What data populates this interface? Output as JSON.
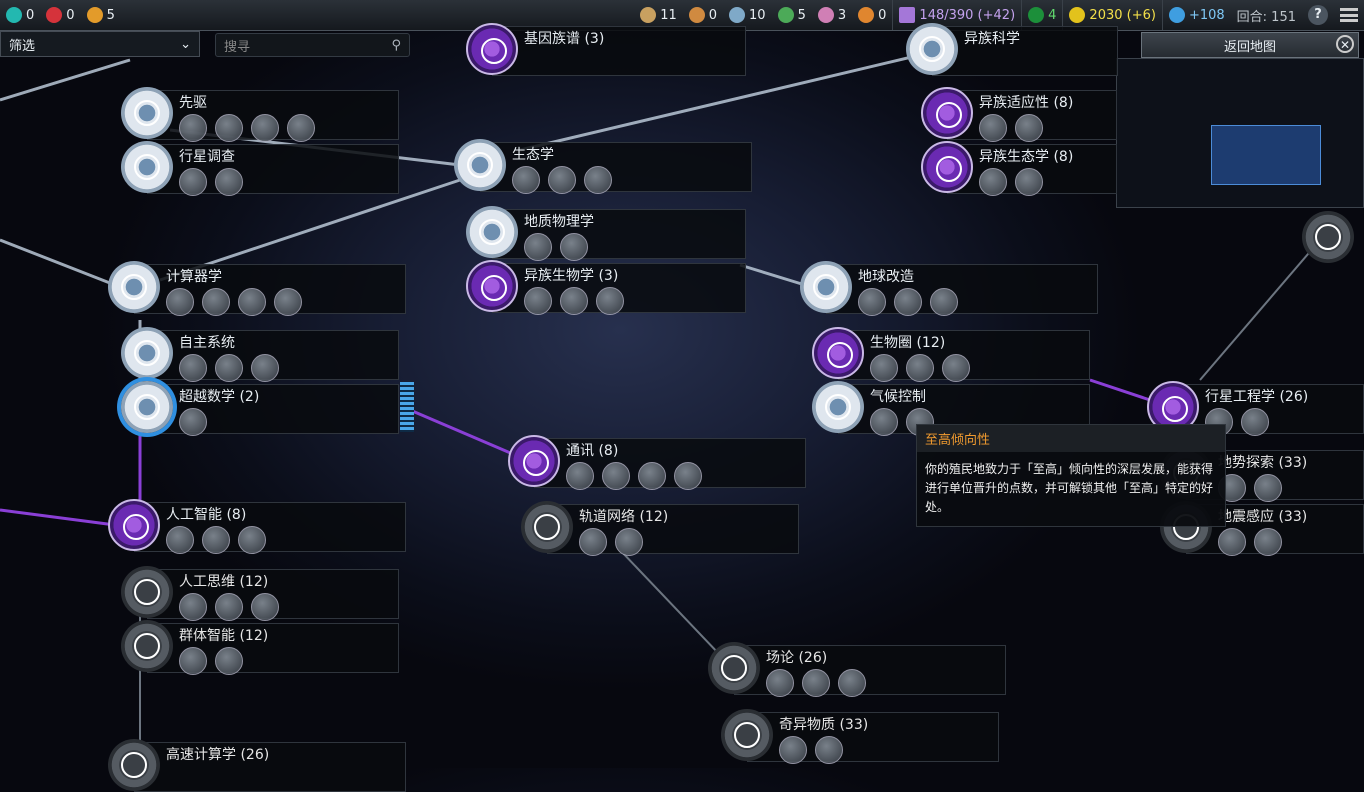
{
  "topbar": {
    "energy": "0",
    "conflict": "0",
    "supremacy": "5",
    "res1": "11",
    "res2": "0",
    "res3": "10",
    "res4": "5",
    "res5": "3",
    "res6": "0",
    "science_progress": "148/390 (+42)",
    "health": "4",
    "energy_income": "2030 (+6)",
    "science_income": "+108",
    "turn": "回合: 151",
    "help": "?"
  },
  "filter": {
    "label": "筛选"
  },
  "search": {
    "placeholder": "搜寻"
  },
  "back_button": "返回地图",
  "tooltip": {
    "title": "至高倾向性",
    "body": "你的殖民地致力于「至高」倾向性的深层发展，能获得进行单位晋升的点数，并可解锁其他「至高」特定的好处。"
  },
  "techs": {
    "genetics": "基因族谱 (3)",
    "xeno_science": "异族科学",
    "pioneer": "先驱",
    "planet_survey": "行星调查",
    "ecology": "生态学",
    "xeno_adaptation": "异族适应性 (8)",
    "xeno_ecology": "异族生态学 (8)",
    "geophysics": "地质物理学",
    "xeno_biology": "异族生物学 (3)",
    "computing": "计算器学",
    "terraforming": "地球改造",
    "autonomous": "自主系统",
    "biosphere": "生物圈 (12)",
    "transcendental_math": "超越数学 (2)",
    "climate_control": "气候控制",
    "planetary_engineering": "行星工程学 (26)",
    "communications": "通讯 (8)",
    "geo_survey": "地势探索 (33)",
    "orbital_networks": "轨道网络 (12)",
    "seismic_sensing": "地震感应 (33)",
    "ai": "人工智能 (8)",
    "artificial_mind": "人工思维 (12)",
    "swarm_intelligence": "群体智能 (12)",
    "field_theory": "场论 (26)",
    "exotic_matter": "奇异物质 (33)",
    "hpc": "高速计算学 (26)"
  },
  "colors": {
    "supremacy_accent": "#f09a2f",
    "affinity_purple": "#8a3fd6",
    "link_white": "#b9c7d6"
  }
}
